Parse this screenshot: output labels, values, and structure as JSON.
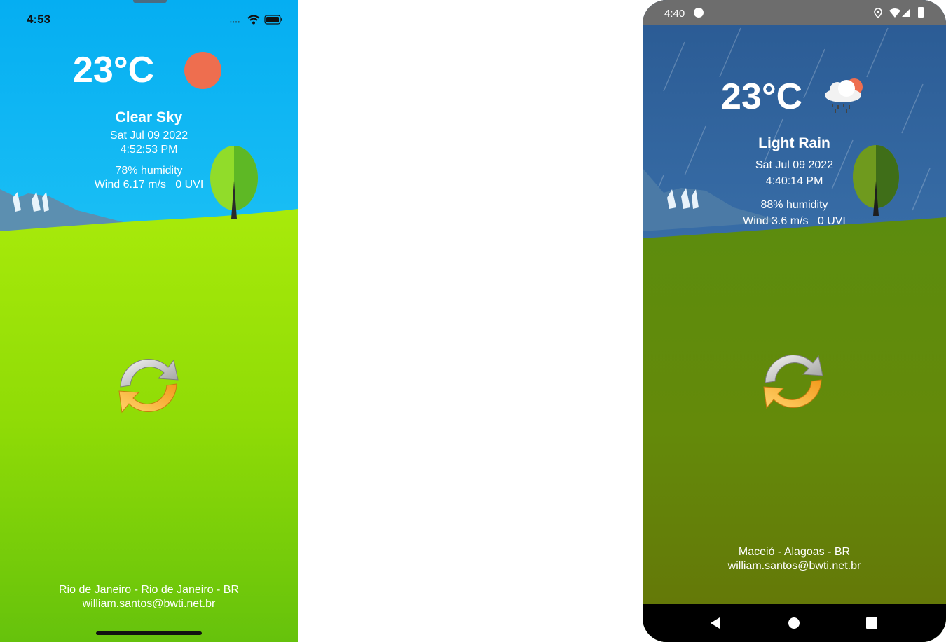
{
  "ios": {
    "status_time": "4:53",
    "temperature": "23°C",
    "condition": "Clear Sky",
    "date": "Sat Jul 09 2022",
    "time": "4:52:53 PM",
    "humidity": "78% humidity",
    "wind": "Wind 6.17 m/s",
    "uvi": "0 UVI",
    "location": "Rio de Janeiro - Rio de Janeiro - BR",
    "email": "william.santos@bwti.net.br",
    "weather_icon": "sun-icon",
    "refresh_icon": "refresh-icon",
    "colors": {
      "sky_top": "#0db3f0",
      "sky_mid": "#2fd4f6",
      "grass_top": "#a7e80c",
      "grass_bottom": "#6cc20a",
      "sun": "#ee6e4f"
    }
  },
  "android": {
    "status_time": "4:40",
    "temperature": "23°C",
    "condition": "Light Rain",
    "date": "Sat Jul 09 2022",
    "time": "4:40:14 PM",
    "humidity": "88% humidity",
    "wind": "Wind 3.6 m/s",
    "uvi": "0 UVI",
    "location": "Maceió - Alagoas - BR",
    "email": "william.santos@bwti.net.br",
    "weather_icon": "rain-cloud-icon",
    "refresh_icon": "refresh-icon",
    "nav_icons": [
      "back-icon",
      "home-icon",
      "recents-icon"
    ],
    "colors": {
      "sky_top": "#2d5d98",
      "sky_mid": "#4a86c4",
      "grass_top": "#5f8c0c",
      "grass_bottom": "#63760a",
      "status_bar": "#6d6d6d"
    }
  }
}
